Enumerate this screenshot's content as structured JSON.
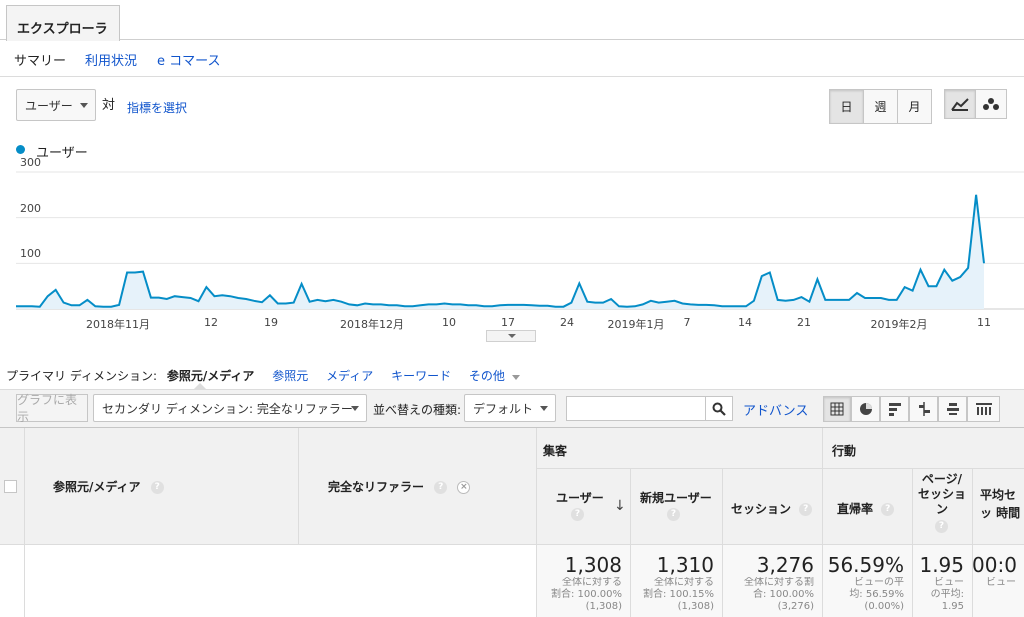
{
  "tabs": {
    "explorer": "エクスプローラ"
  },
  "subtabs": [
    "サマリー",
    "利用状況",
    "e コマース"
  ],
  "metric": {
    "selected": "ユーザー",
    "vs": "対",
    "select_metric": "指標を選択"
  },
  "period_buttons": [
    "日",
    "週",
    "月"
  ],
  "chart_data": {
    "type": "area",
    "legend": [
      "ユーザー"
    ],
    "series": [
      {
        "name": "ユーザー",
        "color": "#058dc7",
        "values": [
          6,
          6,
          6,
          5,
          28,
          42,
          14,
          8,
          8,
          20,
          6,
          5,
          5,
          9,
          80,
          80,
          82,
          25,
          25,
          22,
          28,
          26,
          24,
          17,
          48,
          28,
          30,
          28,
          24,
          22,
          18,
          15,
          30,
          12,
          12,
          14,
          55,
          16,
          20,
          17,
          20,
          16,
          10,
          8,
          12,
          10,
          10,
          8,
          8,
          6,
          6,
          8,
          10,
          10,
          12,
          10,
          10,
          8,
          8,
          6,
          6,
          8,
          9,
          9,
          9,
          8,
          7,
          7,
          5,
          5,
          14,
          56,
          16,
          14,
          14,
          22,
          6,
          5,
          6,
          10,
          18,
          14,
          16,
          18,
          12,
          10,
          9,
          9,
          8,
          6,
          6,
          6,
          6,
          18,
          72,
          80,
          20,
          18,
          20,
          26,
          16,
          65,
          20,
          20,
          20,
          20,
          35,
          24,
          24,
          24,
          20,
          20,
          48,
          40,
          86,
          50,
          50,
          86,
          62,
          70,
          90,
          250,
          100
        ]
      }
    ],
    "x_tick_labels": [
      "2018年11月",
      "12",
      "19",
      "2018年12月",
      "10",
      "17",
      "24",
      "2019年1月",
      "7",
      "14",
      "21",
      "2019年2月",
      "11"
    ],
    "y_tick_labels": [
      "300",
      "200",
      "100"
    ],
    "ylim": [
      0,
      300
    ],
    "grid": true
  },
  "dimensions": {
    "label": "プライマリ ディメンション:",
    "options": [
      "参照元/メディア",
      "参照元",
      "メディア",
      "キーワード",
      "その他"
    ]
  },
  "toolbar": {
    "graph_button": "グラフに表示",
    "secondary": "セカンダリ ディメンション: 完全なリファラー",
    "sort_label": "並べ替えの種類:",
    "sort_value": "デフォルト",
    "search_placeholder": "",
    "advanced": "アドバンス"
  },
  "table": {
    "group_headers": [
      "集客",
      "行動"
    ],
    "col_source": "参照元/メディア",
    "col_referrer": "完全なリファラー",
    "columns": [
      "ユーザー",
      "新規ユーザー",
      "セッション",
      "直帰率",
      "ページ/セッション",
      "平均セッ 時間"
    ],
    "totals": [
      {
        "value": "1,308",
        "line1": "全体に対する",
        "line2": "割合: 100.00%",
        "line3": "(1,308)"
      },
      {
        "value": "1,310",
        "line1": "全体に対する",
        "line2": "割合: 100.15%",
        "line3": "(1,308)"
      },
      {
        "value": "3,276",
        "line1": "全体に対する割",
        "line2": "合: 100.00%",
        "line3": "(3,276)"
      },
      {
        "value": "56.59%",
        "line1": "ビューの平",
        "line2": "均: 56.59%",
        "line3": "(0.00%)"
      },
      {
        "value": "1.95",
        "line1": "ビュー",
        "line2": "の平均:",
        "line3": "1.95"
      },
      {
        "value": "00:0",
        "line1": "ビュー",
        "line2": "",
        "line3": ""
      }
    ]
  }
}
